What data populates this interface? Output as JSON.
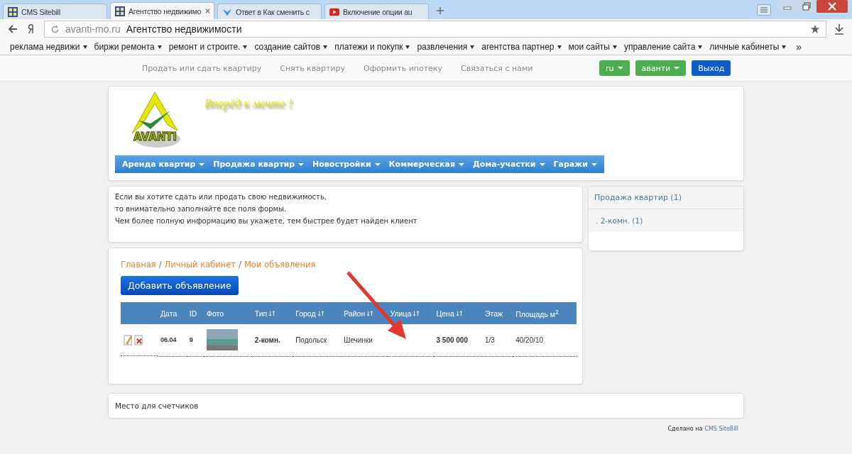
{
  "browser": {
    "tabs": [
      {
        "title": "CMS Sitebill",
        "selected": false,
        "closable": false
      },
      {
        "title": "Агентство недвижимо",
        "selected": true,
        "closable": true
      },
      {
        "title": "Ответ в Как сменить с",
        "selected": false,
        "closable": false
      },
      {
        "title": "Включение опции au",
        "selected": false,
        "closable": false
      }
    ],
    "address_domain": "avanti-mo.ru",
    "address_title": "Агентство недвижимости",
    "bookmarks": [
      "реклама недвижи",
      "биржи ремонта",
      "ремонт и строите.",
      "создание сайтов",
      "платежи и покупк",
      "развлечения",
      "агентства партнер",
      "мои сайты",
      "управление сайта",
      "личные кабинеты"
    ],
    "bookmarks_more": "»"
  },
  "topbar": {
    "links": [
      "Продать или сдать квартиру",
      "Снять квартиру",
      "Оформить ипотеку",
      "Связаться с нами"
    ],
    "buttons": [
      {
        "label": "ru",
        "kind": "dropdown"
      },
      {
        "label": "аванти",
        "kind": "dropdown"
      },
      {
        "label": "Выход",
        "kind": "primary"
      }
    ]
  },
  "header": {
    "logo_text": "AVANTI",
    "slogan": "Вперёд к мечте !",
    "menu": [
      "Аренда квартир",
      "Продажа квартир",
      "Новостройки",
      "Коммерческая",
      "Дома-участки",
      "Гаражи"
    ]
  },
  "info": [
    "Если вы хотите сдать или продать свою недвижимость,",
    "то внимательно заполняйте все поля формы.",
    "Чем более полную информацию вы укажете, тем быстрее будет найден клиент"
  ],
  "sidebar": {
    "category": "Продажа квартир (1)",
    "items": [
      ". 2-комн. (1)"
    ]
  },
  "listings": {
    "breadcrumbs": [
      "Главная",
      "Личный кабинет",
      "Мои объявления"
    ],
    "separator": "/",
    "add_button": "Добавить объявление",
    "columns": [
      {
        "sortable": false
      },
      {
        "label": "Дата",
        "sortable": false
      },
      {
        "label": "ID",
        "sortable": false
      },
      {
        "label": "Фото",
        "sortable": false
      },
      {
        "label": "Тип",
        "sortable": true
      },
      {
        "label": "Город",
        "sortable": true
      },
      {
        "label": "Район",
        "sortable": true
      },
      {
        "label": "Улица",
        "sortable": true
      },
      {
        "label": "Цена",
        "sortable": true
      },
      {
        "label": "Этаж",
        "sortable": false
      },
      {
        "label": "Площадь м$^{2}$",
        "sortable": false
      }
    ],
    "rows": [
      {
        "date": "06.04",
        "id": "9",
        "type": "2-комн.",
        "city": "Подольск",
        "district": "Шечинки",
        "price": "3 500 000",
        "floor": "1/3",
        "area": "40/20/10"
      }
    ]
  },
  "counters": "Место для счетчиков",
  "footer": {
    "text": "Сделано на",
    "link": "CMS SiteBill"
  }
}
